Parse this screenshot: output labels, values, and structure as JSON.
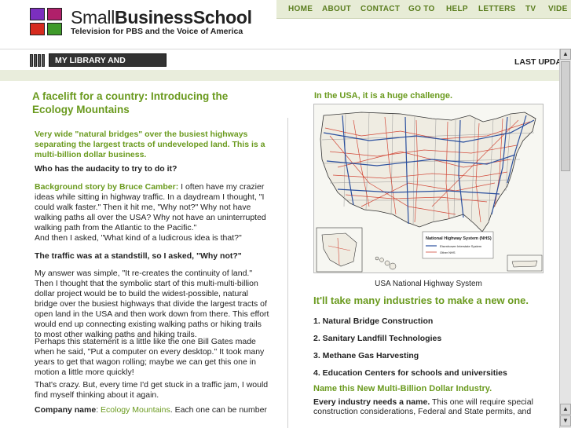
{
  "header": {
    "logo_name_prefix": "Small",
    "logo_name_bold": "BusinessSchool",
    "tagline": "Television for PBS and the Voice of America",
    "nav": [
      "HOME",
      "ABOUT",
      "CONTACT",
      "GO TO",
      "HELP",
      "LETTERS",
      "TV",
      "VIDE"
    ]
  },
  "library": {
    "tab_label": "MY LIBRARY AND COURSES",
    "last_update": "LAST UPDA"
  },
  "article": {
    "headline": "A facelift for a country: Introducing the Ecology Mountains",
    "lead": "Very wide \"natural bridges\" over the busiest highways separating the largest tracts of undeveloped land.   This is a multi-billion dollar business.",
    "q1": "Who has the audacity to try to do it?",
    "bg_label": "Background story by  Bruce Camber:",
    "bg_text": " I often have my crazier ideas while sitting in highway traffic.  In a daydream I thought, \"I could walk faster.\"  Then it hit me, \"Why not?\" Why not have walking paths all over the USA?  Why not have an uninterrupted walking path from the Atlantic to the Pacific.\"",
    "p2": "And then I asked, \"What kind of a ludicrous idea is that?\"",
    "p3": "The traffic was at a standstill, so I asked, \"Why not?\"",
    "p4": "My answer was simple, \"It re-creates  the continuity of land.\"  Then I thought that the symbolic start of this multi-multi-billion dollar project would be to build the widest-possible, natural bridge over the busiest highways that divide the largest tracts of open land in the USA and then work down from there.  This effort would end up connecting existing walking paths or hiking trails to most other walking paths and hiking trails.",
    "p5": "Perhaps this statement is a little like the one Bill Gates made when he said,  \"Put a computer on every desktop.\"  It took many years to get that wagon rolling; maybe we can get this one in motion a little more quickly!",
    "p6": "That's crazy.  But, every time I'd get stuck in a traffic jam, I would find myself  thinking about it again.",
    "company_label": "Company name",
    "company_sep": ": ",
    "company_name": "Ecology Mountains",
    "company_tail": ". Each one can be number"
  },
  "sidebar": {
    "title": "In the USA, it is a huge challenge.",
    "map_caption": "USA National Highway System",
    "map_legend_title": "National Highway System (NHS)",
    "map_legend_1": "Eisenhower Interstate System",
    "map_legend_2": "Other NHS",
    "industries_heading": "It'll take many industries to make a new one.",
    "industries": [
      "1.  Natural Bridge Construction",
      "2.  Sanitary Landfill Technologies",
      "3.  Methane Gas Harvesting",
      "4.  Education Centers for schools and universities"
    ],
    "name_heading": "Name this New Multi-Billion Dollar Industry.",
    "name_bold": "Every industry needs a name.",
    "name_text": "  This one will require special construction considerations,  Federal and State permits, and"
  },
  "colors": {
    "accent_green": "#6a9a1e",
    "nav_bg": "#e7ecd6",
    "band_bg": "#e9eddc"
  }
}
